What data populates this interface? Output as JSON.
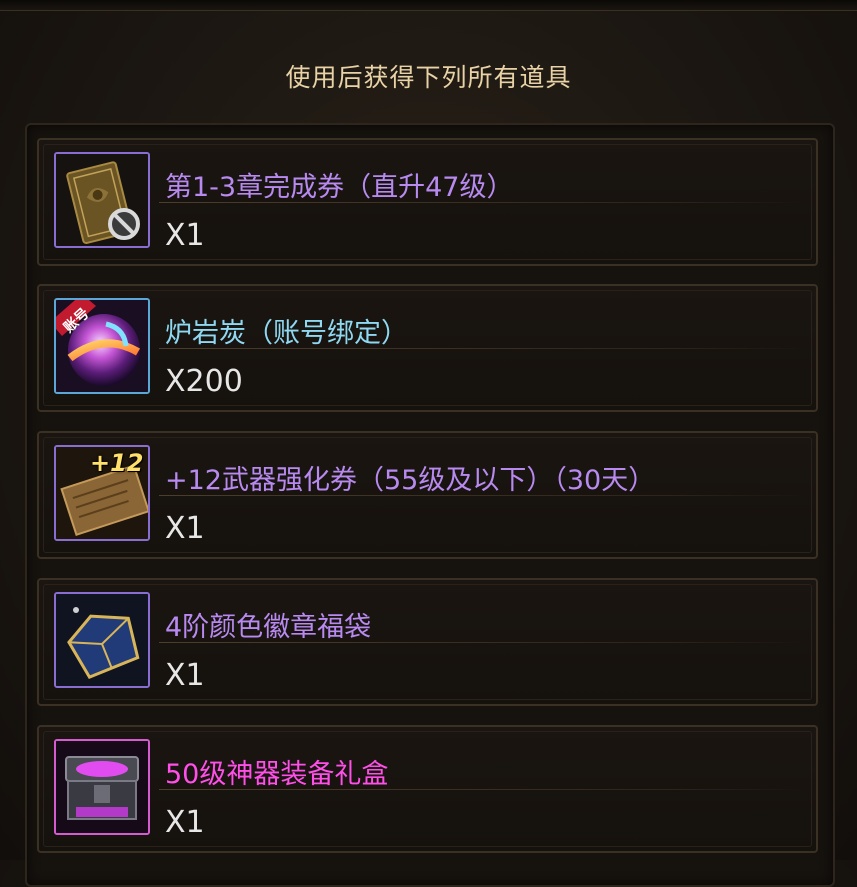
{
  "header": {
    "title": "使用后获得下列所有道具"
  },
  "colors": {
    "purple": "#b88af0",
    "blue": "#8fd8f2",
    "magenta": "#ff4fe8"
  },
  "items": [
    {
      "name": "第1-3章完成券（直升47级）",
      "quantity": "X1",
      "icon": "golden-ticket-icon",
      "rarity_color": "#b88af0",
      "badge": ""
    },
    {
      "name": "炉岩炭（账号绑定）",
      "quantity": "X200",
      "icon": "lava-orb-icon",
      "rarity_color": "#8fd8f2",
      "badge": "账号"
    },
    {
      "name": "+12武器强化券（55级及以下）（30天）",
      "quantity": "X1",
      "icon": "upgrade-scroll-icon",
      "rarity_color": "#b88af0",
      "badge": "+12"
    },
    {
      "name": "4阶颜色徽章福袋",
      "quantity": "X1",
      "icon": "emblem-bag-icon",
      "rarity_color": "#b88af0",
      "badge": ""
    },
    {
      "name": "50级神器装备礼盒",
      "quantity": "X1",
      "icon": "gift-box-icon",
      "rarity_color": "#ff4fe8",
      "badge": ""
    }
  ]
}
